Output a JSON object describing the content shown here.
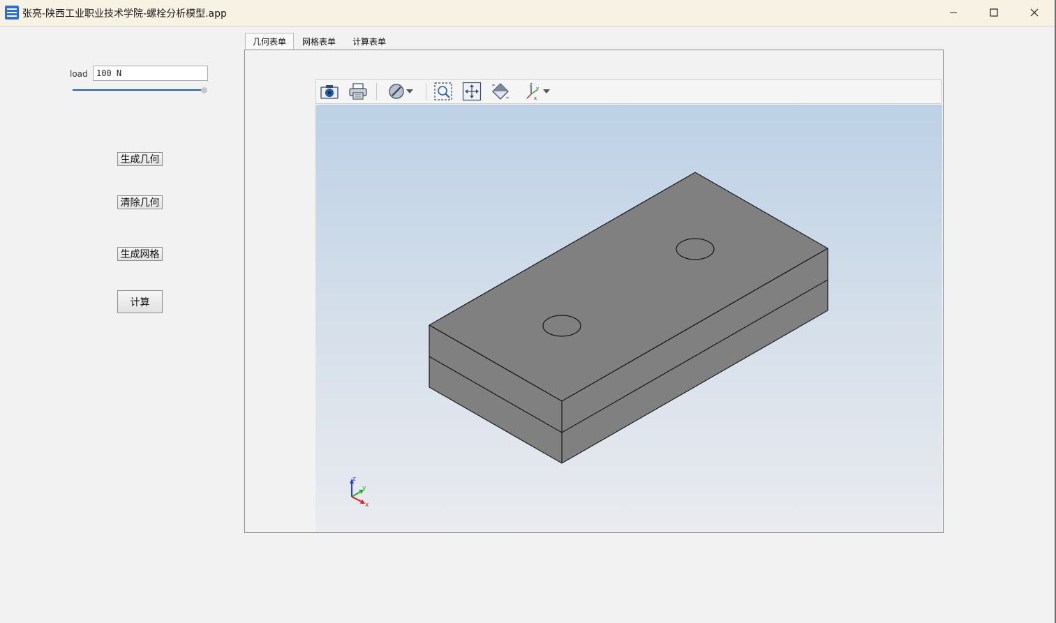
{
  "window": {
    "title": "张亮-陕西工业职业技术学院-螺栓分析模型.app",
    "icon": "app-icon",
    "controls": [
      "minimize-icon",
      "maximize-icon",
      "close-icon"
    ]
  },
  "load": {
    "label": "load",
    "value": "100 N",
    "slider_fraction": 1.0
  },
  "buttons": {
    "generate_geometry": "生成几何",
    "clear_geometry": "清除几何",
    "generate_mesh": "生成网格",
    "compute": "计算"
  },
  "tabs": [
    {
      "label": "几何表单",
      "active": true
    },
    {
      "label": "网格表单",
      "active": false
    },
    {
      "label": "计算表单",
      "active": false
    }
  ],
  "toolbar": {
    "items": [
      "camera-icon",
      "print-icon",
      "visibility-icon",
      "zoom-box-icon",
      "zoom-extents-icon",
      "scene-light-icon",
      "view-orientation-icon"
    ]
  },
  "axes": {
    "x": "x",
    "y": "y",
    "z": "z"
  },
  "colors": {
    "model_face": "#808080",
    "axis_x": "#e02020",
    "axis_y": "#20b020",
    "axis_z": "#2040e0",
    "slider": "#1a5fb4"
  }
}
